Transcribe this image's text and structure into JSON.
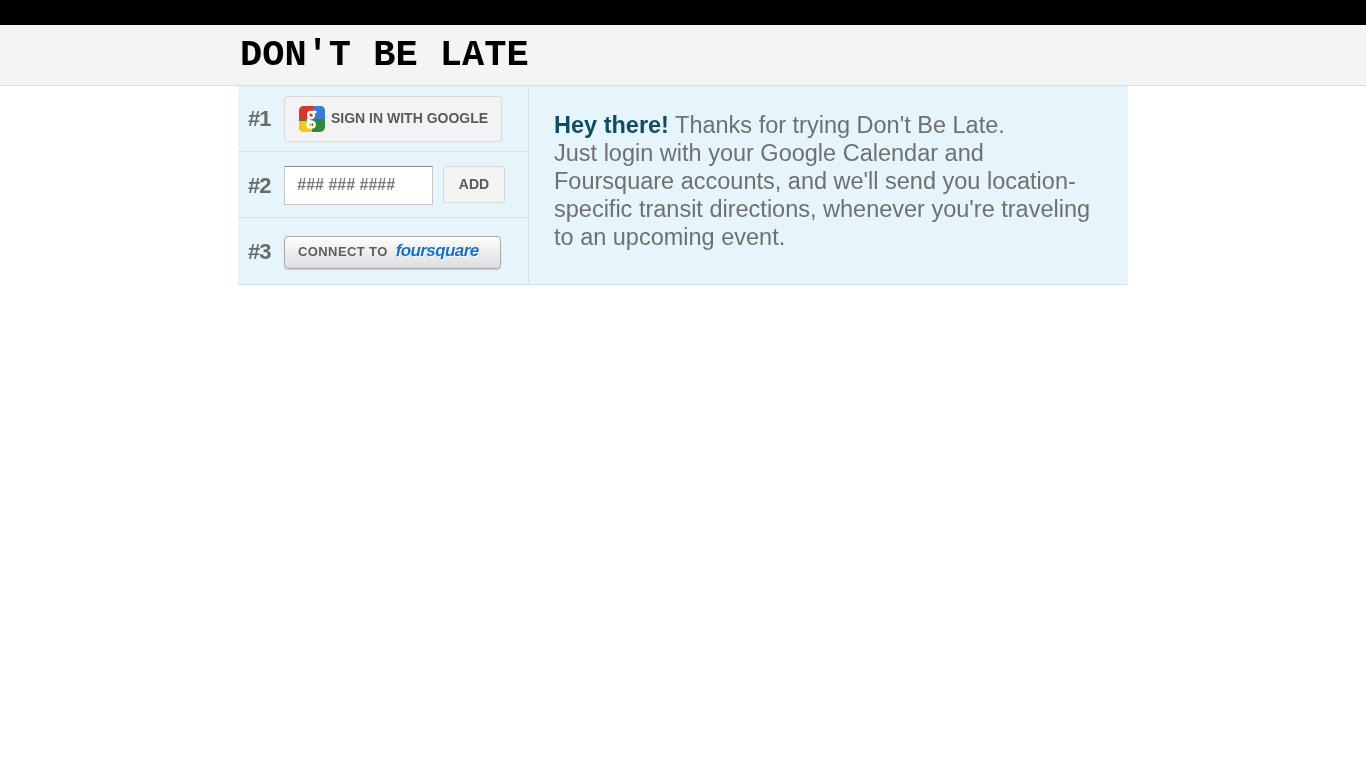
{
  "header": {
    "title": "DON'T BE LATE"
  },
  "steps": [
    {
      "number": "#1",
      "kind": "google_button",
      "button": {
        "label": "SIGN IN WITH GOOGLE"
      }
    },
    {
      "number": "#2",
      "kind": "phone_field",
      "field": {
        "placeholder": "### ### ####"
      },
      "button": {
        "label": "ADD"
      }
    },
    {
      "number": "#3",
      "kind": "connect_button",
      "button": {
        "label": "CONNECT TO",
        "logo_text": "foursquare"
      }
    }
  ],
  "intro": {
    "greeting": "**Hey there!** Thanks for trying Don't Be Late.",
    "body": "Just login with your Google Calendar and Foursquare accounts, and we'll send you location-specific transit directions, whenever you're traveling to an upcoming event."
  }
}
